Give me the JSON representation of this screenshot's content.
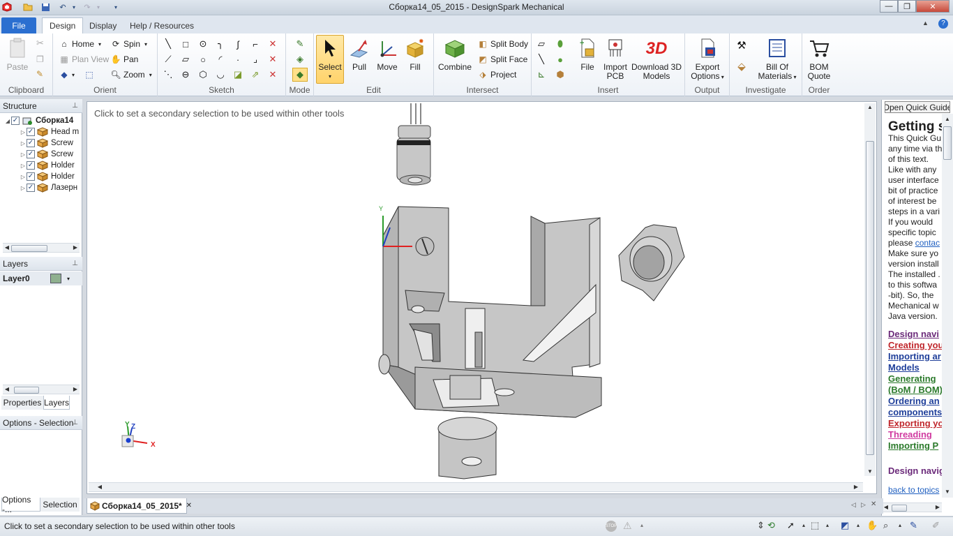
{
  "window": {
    "title": "Сборка14_05_2015 - DesignSpark Mechanical",
    "controls": {
      "minimize": "—",
      "maximize": "❐",
      "close": "✕"
    }
  },
  "ribbon_tabs": [
    "File",
    "Design",
    "Display",
    "Help / Resources"
  ],
  "ribbon": {
    "clipboard": {
      "label": "Clipboard",
      "paste": "Paste"
    },
    "orient": {
      "label": "Orient",
      "home": "Home",
      "spin": "Spin",
      "plan_view": "Plan View",
      "pan": "Pan",
      "zoom": "Zoom"
    },
    "sketch": {
      "label": "Sketch"
    },
    "mode": {
      "label": "Mode"
    },
    "edit": {
      "label": "Edit",
      "select": "Select",
      "pull": "Pull",
      "move": "Move",
      "fill": "Fill"
    },
    "intersect": {
      "label": "Intersect",
      "combine": "Combine",
      "split_body": "Split Body",
      "split_face": "Split Face",
      "project": "Project"
    },
    "insert": {
      "label": "Insert",
      "file": "File",
      "import_pcb_1": "Import",
      "import_pcb_2": "PCB",
      "download_1": "Download 3D",
      "download_2": "Models",
      "download_icon": "3D"
    },
    "output": {
      "label": "Output",
      "export_1": "Export",
      "export_2": "Options"
    },
    "investigate": {
      "label": "Investigate",
      "bom_1": "Bill Of",
      "bom_2": "Materials"
    },
    "order": {
      "label": "Order",
      "bom_quote_1": "BOM",
      "bom_quote_2": "Quote"
    }
  },
  "structure": {
    "title": "Structure",
    "root": "Сборка14",
    "items": [
      "Head m",
      "Screw",
      "Screw",
      "Holder",
      "Holder",
      "Лазерн"
    ]
  },
  "layers": {
    "title": "Layers",
    "layer0": "Layer0",
    "layer0_color": "#8fb08f"
  },
  "panel_tabs": {
    "properties": "Properties",
    "layers": "Layers"
  },
  "options_panel": {
    "title": "Options - Selection"
  },
  "bottom_left_tabs": {
    "options": "Options -...",
    "selection": "Selection"
  },
  "viewport": {
    "hint": "Click to set a secondary selection to be used within other tools",
    "axis_x": "X",
    "axis_y": "Y",
    "axis_z": "Z"
  },
  "quick_guide": {
    "button": "Open Quick Guide",
    "heading": "Getting s",
    "lines": [
      "This Quick Gu",
      "any time via th",
      "of this text.",
      "Like with any",
      "user interface",
      "bit of practice",
      "of interest  be",
      "steps in a vari",
      "If  you  would",
      "specific topic",
      "please",
      "Make sure yo",
      "version install",
      "The installed .",
      "to this softwa",
      "-bit).  So,  the",
      "Mechanical  w",
      "Java version."
    ],
    "contact_link": "contac",
    "links": [
      {
        "text": "Design navi",
        "color": "#6b2a7a"
      },
      {
        "text": "Creating you",
        "color": "#c0282d"
      },
      {
        "text": "Importing ar",
        "color": "#1f3f9a"
      },
      {
        "text": "Models",
        "color": "#1f3f9a"
      },
      {
        "text": "Generating",
        "color": "#2b7a2b"
      },
      {
        "text": "(BoM / BOM)",
        "color": "#2b7a2b"
      },
      {
        "text": "Ordering an",
        "color": "#1f3f9a"
      },
      {
        "text": "components",
        "color": "#1f3f9a"
      },
      {
        "text": "Exporting yo",
        "color": "#c0282d"
      },
      {
        "text": "Threading",
        "color": "#d03aa0"
      },
      {
        "text": "Importing P",
        "color": "#2b7a2b"
      }
    ],
    "section2": "Design navig",
    "back_link": "back to topics"
  },
  "doc_tab": {
    "name": "Сборка14_05_2015*",
    "close": "✕"
  },
  "status": {
    "text": "Click to set a secondary selection to be used within other tools"
  }
}
